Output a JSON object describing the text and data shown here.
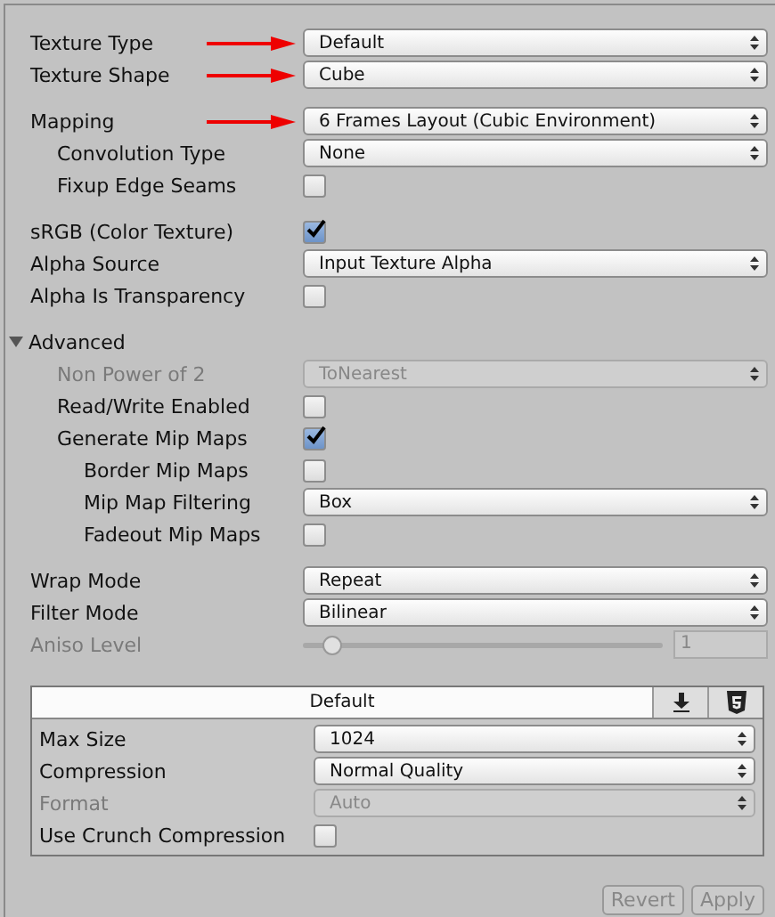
{
  "groups": [
    {
      "rows": [
        {
          "kind": "dropdown",
          "label": "Texture Type",
          "value": "Default",
          "pointer": true
        },
        {
          "kind": "dropdown",
          "label": "Texture Shape",
          "value": "Cube",
          "pointer": true
        }
      ]
    },
    {
      "rows": [
        {
          "kind": "dropdown",
          "label": "Mapping",
          "value": "6 Frames Layout (Cubic Environment)",
          "pointer": true,
          "children": [
            {
              "kind": "dropdown",
              "label": "Convolution Type",
              "value": "None"
            },
            {
              "kind": "checkbox",
              "label": "Fixup Edge Seams",
              "checked": false
            }
          ]
        }
      ]
    },
    {
      "rows": [
        {
          "kind": "checkbox",
          "label": "sRGB (Color Texture)",
          "checked": true
        },
        {
          "kind": "dropdown",
          "label": "Alpha Source",
          "value": "Input Texture Alpha"
        },
        {
          "kind": "checkbox",
          "label": "Alpha Is Transparency",
          "checked": false
        }
      ]
    },
    {
      "rows": [
        {
          "kind": "foldout",
          "label": "Advanced",
          "expanded": true,
          "children": [
            {
              "kind": "dropdown",
              "label": "Non Power of 2",
              "value": "ToNearest",
              "disabled": true
            },
            {
              "kind": "checkbox",
              "label": "Read/Write Enabled",
              "checked": false
            },
            {
              "kind": "checkbox",
              "label": "Generate Mip Maps",
              "checked": true,
              "children": [
                {
                  "kind": "checkbox",
                  "label": "Border Mip Maps",
                  "checked": false
                },
                {
                  "kind": "dropdown",
                  "label": "Mip Map Filtering",
                  "value": "Box"
                },
                {
                  "kind": "checkbox",
                  "label": "Fadeout Mip Maps",
                  "checked": false
                }
              ]
            }
          ]
        }
      ]
    },
    {
      "rows": [
        {
          "kind": "dropdown",
          "label": "Wrap Mode",
          "value": "Repeat"
        },
        {
          "kind": "dropdown",
          "label": "Filter Mode",
          "value": "Bilinear"
        },
        {
          "kind": "slider",
          "label": "Aniso Level",
          "level": 0.06,
          "value": "1",
          "disabled": true
        }
      ]
    }
  ],
  "platforms": {
    "tabs": [
      {
        "kind": "default",
        "label": "Default",
        "selected": true
      },
      {
        "kind": "download",
        "selected": false
      },
      {
        "kind": "html5",
        "selected": false
      }
    ],
    "rows": [
      {
        "kind": "dropdown",
        "label": "Max Size",
        "value": "1024"
      },
      {
        "kind": "dropdown",
        "label": "Compression",
        "value": "Normal Quality"
      },
      {
        "kind": "dropdown",
        "label": "Format",
        "value": "Auto",
        "disabled": true
      },
      {
        "kind": "checkbox",
        "label": "Use Crunch Compression",
        "checked": false
      }
    ]
  },
  "buttons": [
    {
      "label": "Revert",
      "disabled": true
    },
    {
      "label": "Apply",
      "disabled": true
    }
  ]
}
